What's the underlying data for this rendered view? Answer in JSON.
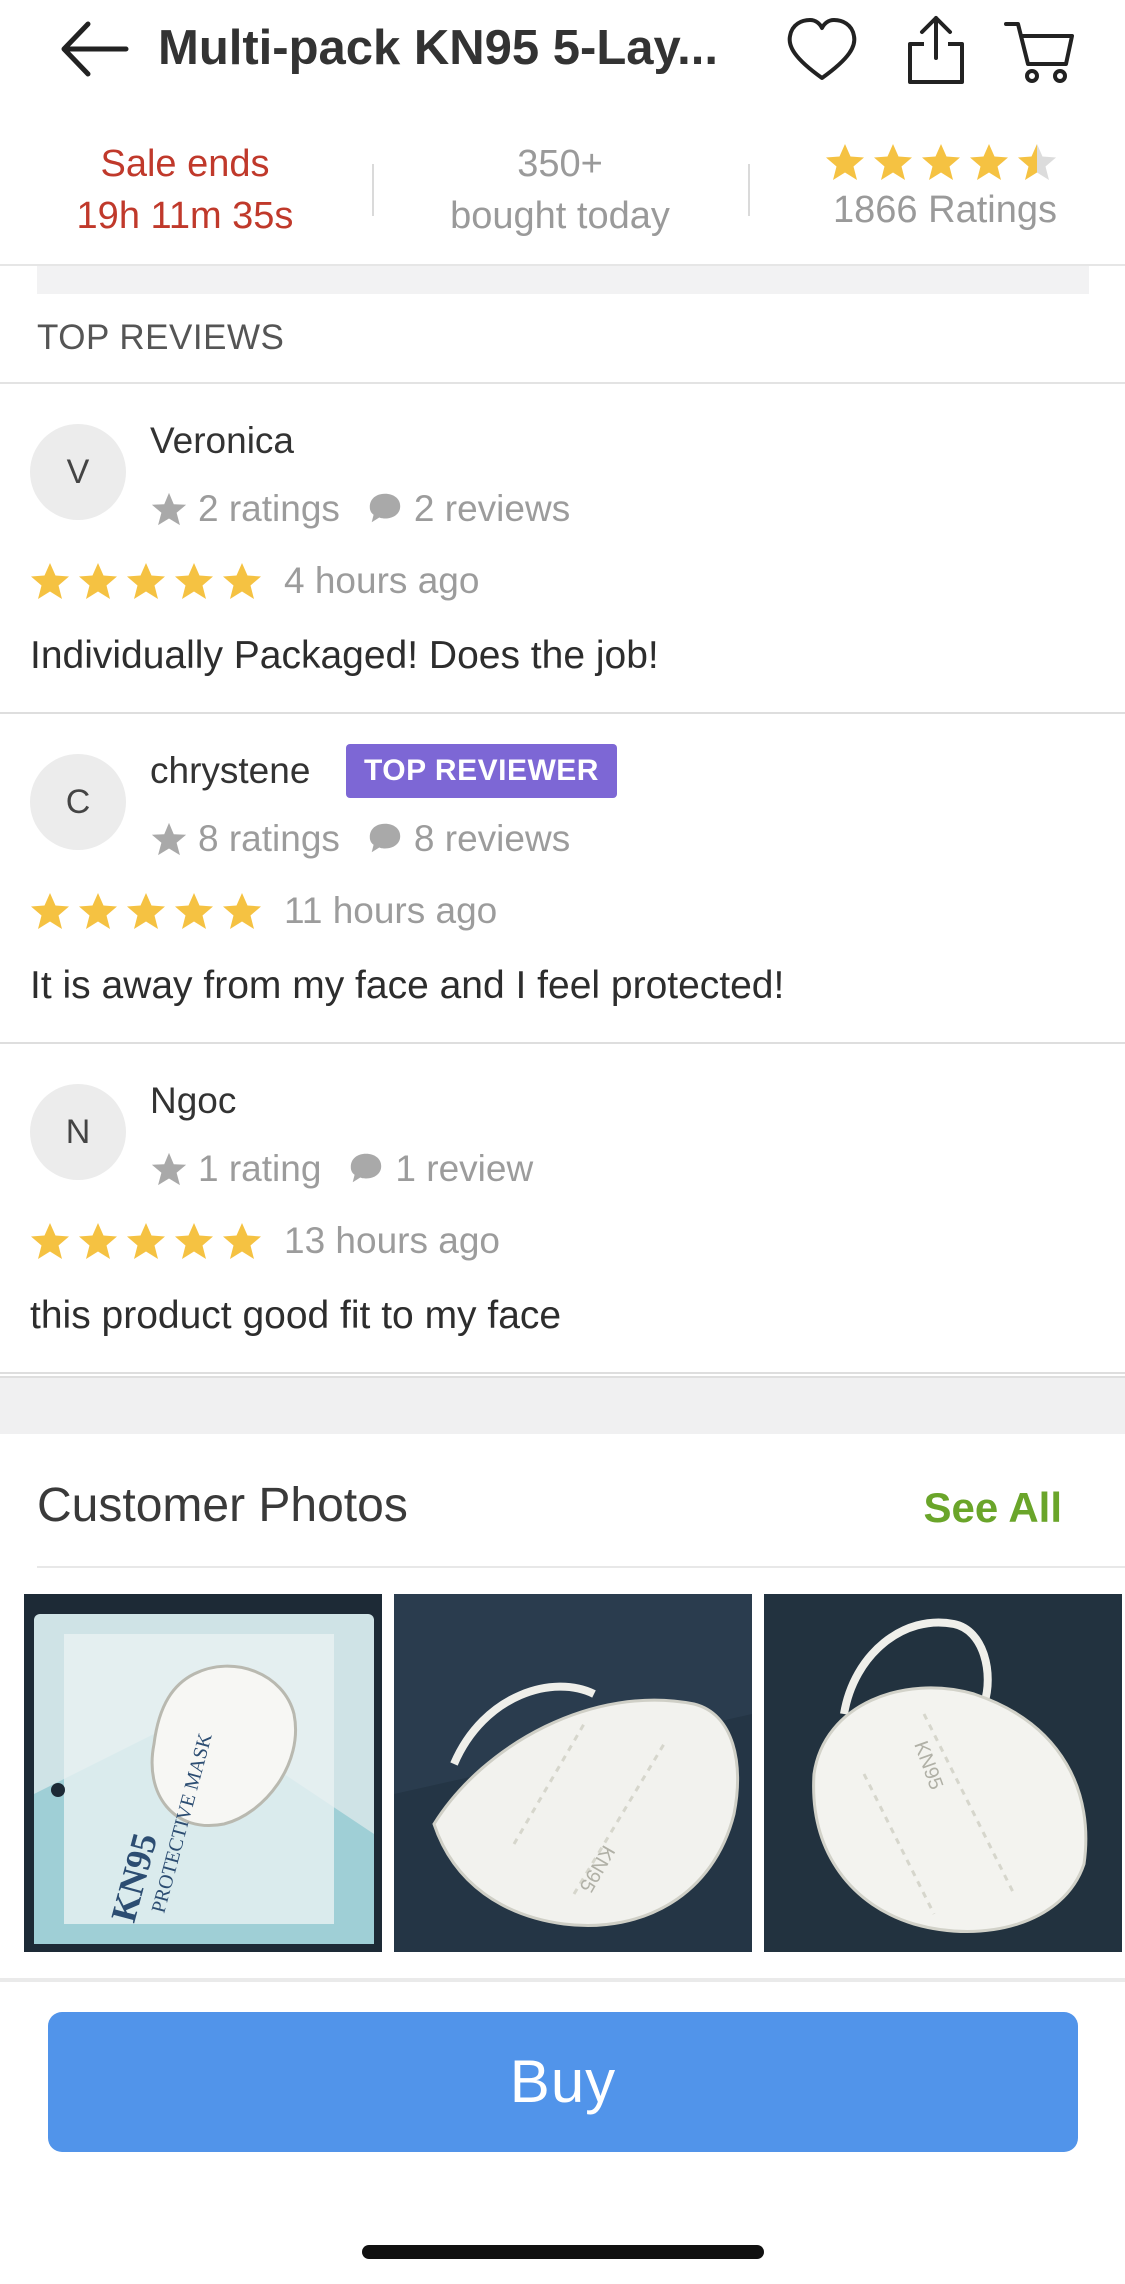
{
  "header": {
    "title": "Multi-pack KN95 5-Lay...",
    "back_icon": "arrow-left-icon",
    "wishlist_icon": "heart-icon",
    "share_icon": "share-icon",
    "cart_icon": "cart-icon"
  },
  "stats": {
    "sale_label": "Sale ends",
    "sale_timer": "19h 11m 35s",
    "bought_count": "350+",
    "bought_label": "bought today",
    "rating_stars": 4.5,
    "ratings_text": "1866  Ratings"
  },
  "colors": {
    "sale_red": "#c0392b",
    "star_gold": "#f5c242",
    "badge_purple": "#7d67d5",
    "see_all_green": "#6aa52a",
    "buy_blue": "#5194ea"
  },
  "reviews_section": {
    "title": "TOP REVIEWS",
    "reviews": [
      {
        "initial": "V",
        "name": "Veronica",
        "badge": "",
        "ratings": "2 ratings",
        "reviews": "2 reviews",
        "stars": 5,
        "time": "4 hours ago",
        "text": "Individually Packaged! Does the job!"
      },
      {
        "initial": "C",
        "name": "chrystene",
        "badge": "TOP REVIEWER",
        "ratings": "8 ratings",
        "reviews": "8 reviews",
        "stars": 5,
        "time": "11 hours ago",
        "text": "It is away from my face and I feel protected!"
      },
      {
        "initial": "N",
        "name": "Ngoc",
        "badge": "",
        "ratings": "1 rating",
        "reviews": "1 review",
        "stars": 5,
        "time": "13 hours ago",
        "text": "this product good fit to my face"
      }
    ]
  },
  "photos_section": {
    "title": "Customer Photos",
    "see_all": "See All",
    "photo_1_text_a": "KN95",
    "photo_1_text_b": "PROTECTIVE MASK",
    "photo_2_text": "KN95",
    "photo_3_text": "KN95"
  },
  "buy_button": "Buy"
}
